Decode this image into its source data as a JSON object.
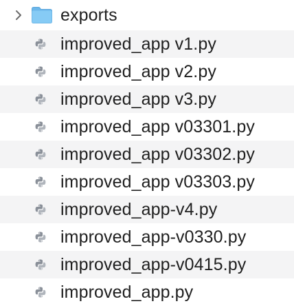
{
  "folder": {
    "name": "exports",
    "icon": "folder-icon",
    "expander_icon": "chevron-right-icon",
    "color": "#7fc5f2"
  },
  "files": [
    {
      "name": "improved_app v1.py",
      "icon": "python-file-icon"
    },
    {
      "name": "improved_app v2.py",
      "icon": "python-file-icon"
    },
    {
      "name": "improved_app v3.py",
      "icon": "python-file-icon"
    },
    {
      "name": "improved_app v03301.py",
      "icon": "python-file-icon"
    },
    {
      "name": "improved_app v03302.py",
      "icon": "python-file-icon"
    },
    {
      "name": "improved_app v03303.py",
      "icon": "python-file-icon"
    },
    {
      "name": "improved_app-v4.py",
      "icon": "python-file-icon"
    },
    {
      "name": "improved_app-v0330.py",
      "icon": "python-file-icon"
    },
    {
      "name": "improved_app-v0415.py",
      "icon": "python-file-icon"
    },
    {
      "name": "improved_app.py",
      "icon": "python-file-icon"
    }
  ]
}
